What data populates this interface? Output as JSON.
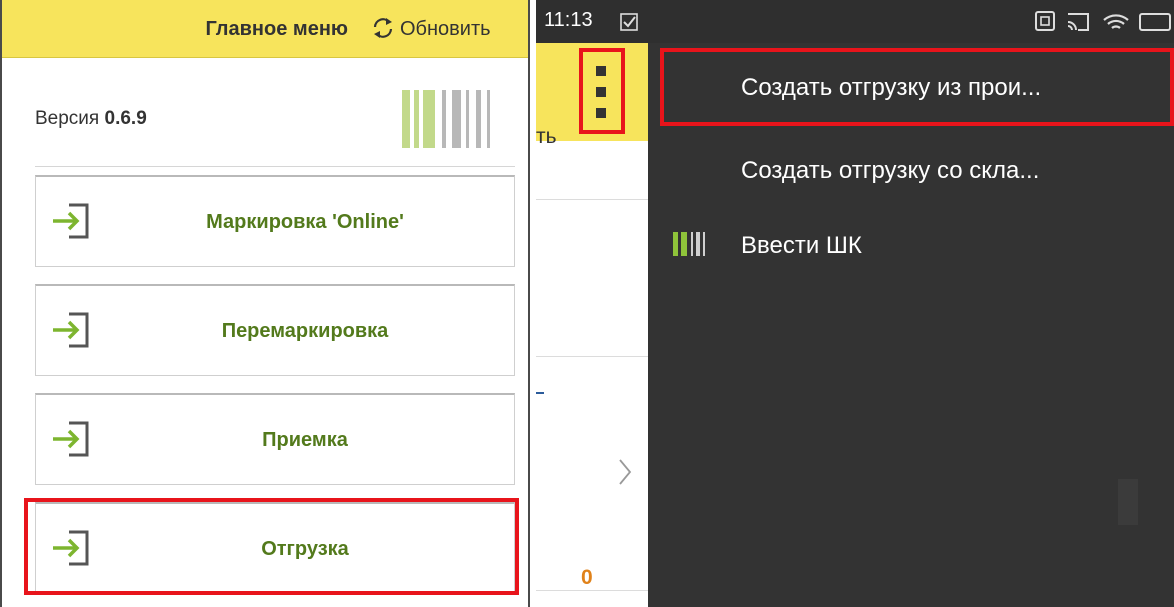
{
  "left_panel": {
    "header": {
      "title": "Главное меню",
      "refresh_label": "Обновить",
      "refresh_icon": "refresh-icon",
      "background": "#f7e45c"
    },
    "version": {
      "label": "Версия",
      "value": "0.6.9"
    },
    "logo_icon": "barcode-logo",
    "buttons": [
      {
        "label": "Маркировка 'Online'",
        "icon": "enter-icon"
      },
      {
        "label": "Перемаркировка",
        "icon": "enter-icon"
      },
      {
        "label": "Приемка",
        "icon": "enter-icon"
      },
      {
        "label": "Отгрузка",
        "icon": "enter-icon",
        "highlighted": true
      }
    ],
    "accent_color": "#537a1c",
    "highlight_color": "#e8141b"
  },
  "status_bar": {
    "time": "11:13",
    "icons": [
      "notification-check-icon",
      "nfc-icon",
      "cast-icon",
      "wifi-icon",
      "battery-icon"
    ]
  },
  "middle": {
    "partial_label": "ть",
    "more_icon": "more-vertical-icon",
    "count": "0",
    "chevron_icon": "chevron-right-icon"
  },
  "dropdown": {
    "items": [
      {
        "label": "Создать отгрузку из прои...",
        "highlighted": true
      },
      {
        "label": "Создать отгрузку со скла..."
      },
      {
        "label": "Ввести ШК",
        "icon": "barcode-icon"
      }
    ],
    "background": "#333333"
  }
}
